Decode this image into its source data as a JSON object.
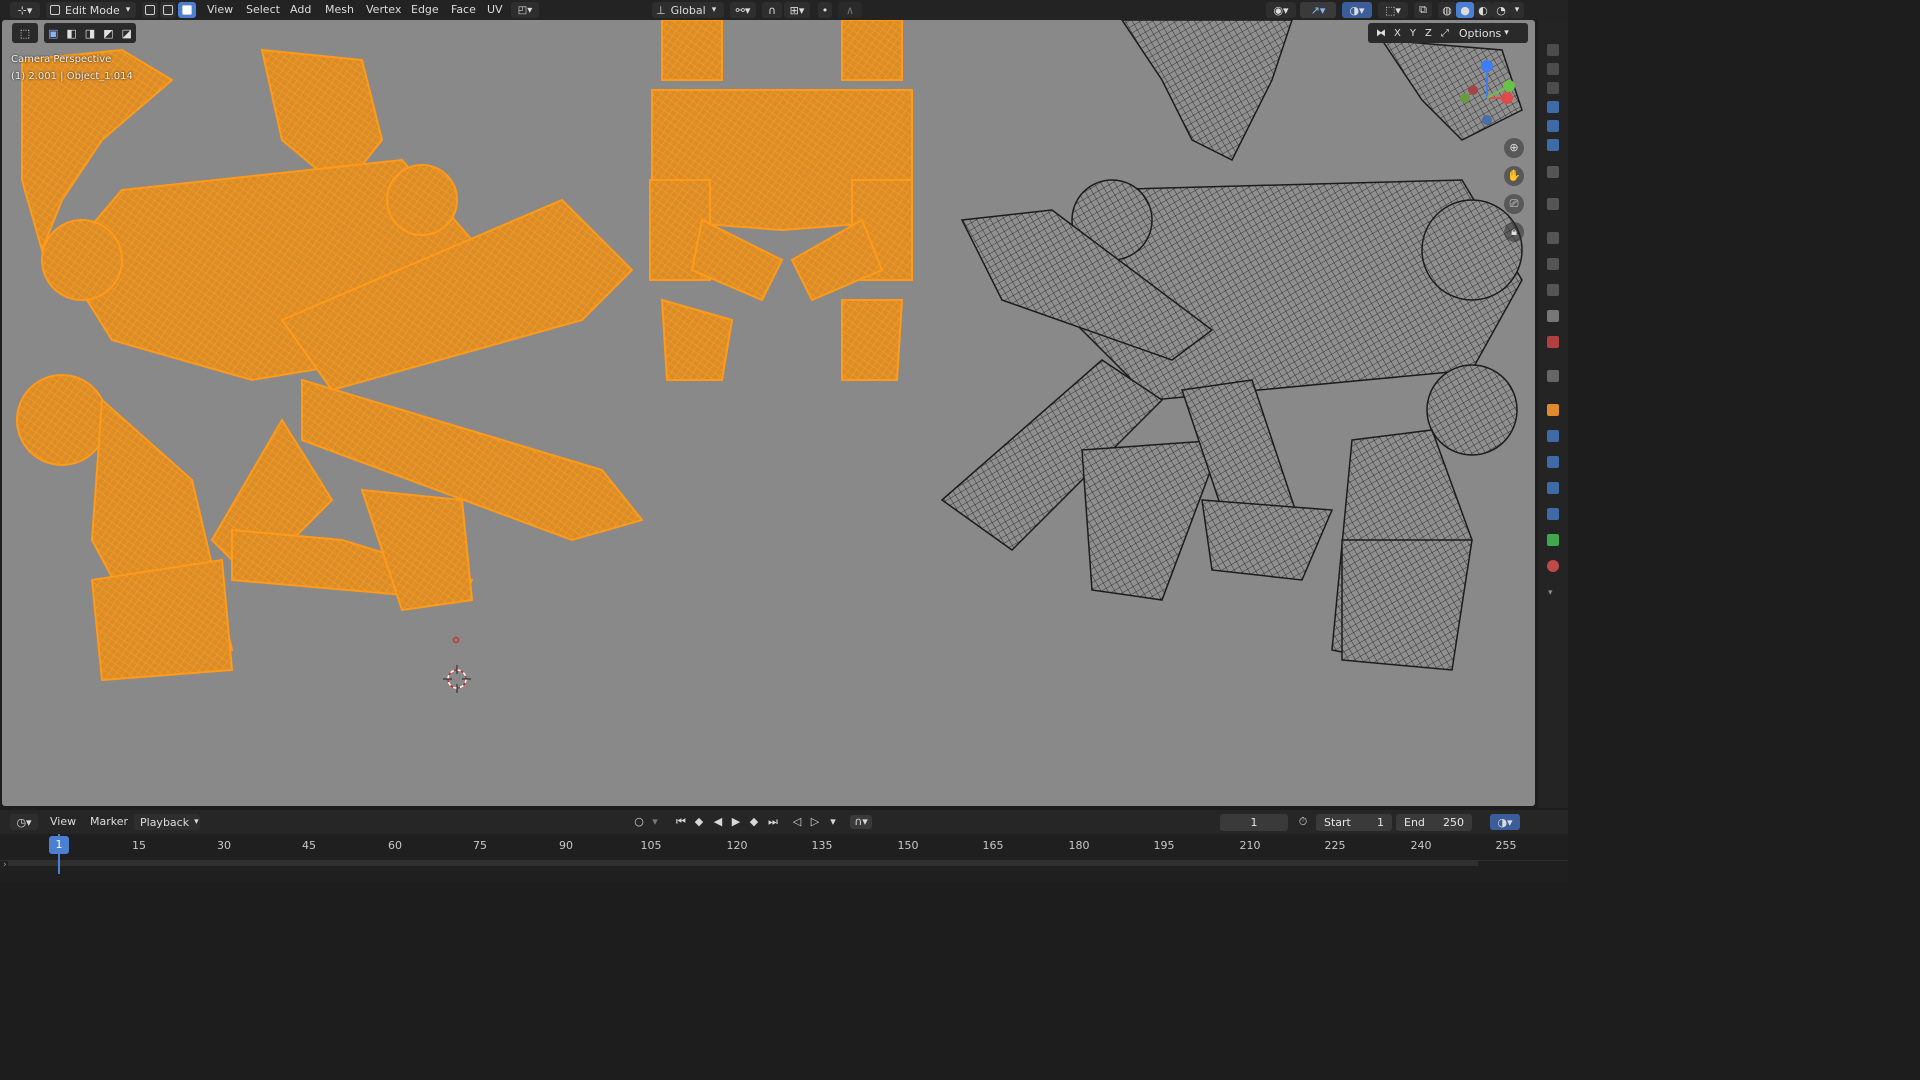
{
  "header": {
    "mode_label": "Edit Mode",
    "menus": [
      "View",
      "Select",
      "Add",
      "Mesh",
      "Vertex",
      "Edge",
      "Face",
      "UV"
    ],
    "orientation_label": "Global",
    "options_label": "Options",
    "axes": [
      "X",
      "Y",
      "Z"
    ]
  },
  "viewport": {
    "camera_label": "Camera Perspective",
    "object_label": "(1) 2.001 | Object_1.014"
  },
  "timeline": {
    "menus": [
      "View",
      "Marker",
      "Playback"
    ],
    "current_frame": "1",
    "start_label": "Start",
    "start_value": "1",
    "end_label": "End",
    "end_value": "250",
    "playhead_value": "1",
    "ticks": [
      "15",
      "30",
      "45",
      "60",
      "75",
      "90",
      "105",
      "120",
      "135",
      "150",
      "165",
      "180",
      "195",
      "210",
      "225",
      "240",
      "255"
    ]
  },
  "colors": {
    "selected_wire": "#ff9a1a",
    "unselected_wire": "#1c1c1c",
    "viewport_bg": "#898989",
    "accent_blue": "#4a7fd1"
  }
}
